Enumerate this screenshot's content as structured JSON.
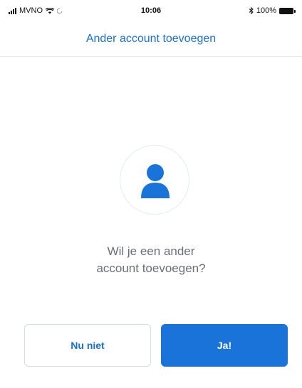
{
  "status_bar": {
    "carrier": "MVNO",
    "time": "10:06",
    "battery": "100%",
    "icons": {
      "signal": "signal-icon",
      "wifi": "wifi-icon",
      "activity": "activity-icon",
      "bluetooth": "bluetooth-icon",
      "battery": "battery-icon"
    }
  },
  "header": {
    "title": "Ander account toevoegen"
  },
  "avatar": {
    "icon": "user-icon"
  },
  "main": {
    "question_line1": "Wil je een ander",
    "question_line2": "account toevoegen?"
  },
  "actions": {
    "decline_label": "Nu niet",
    "confirm_label": "Ja!"
  },
  "colors": {
    "accent": "#1a73d9",
    "title": "#1a6fd4",
    "text_muted": "#6b6f76"
  }
}
